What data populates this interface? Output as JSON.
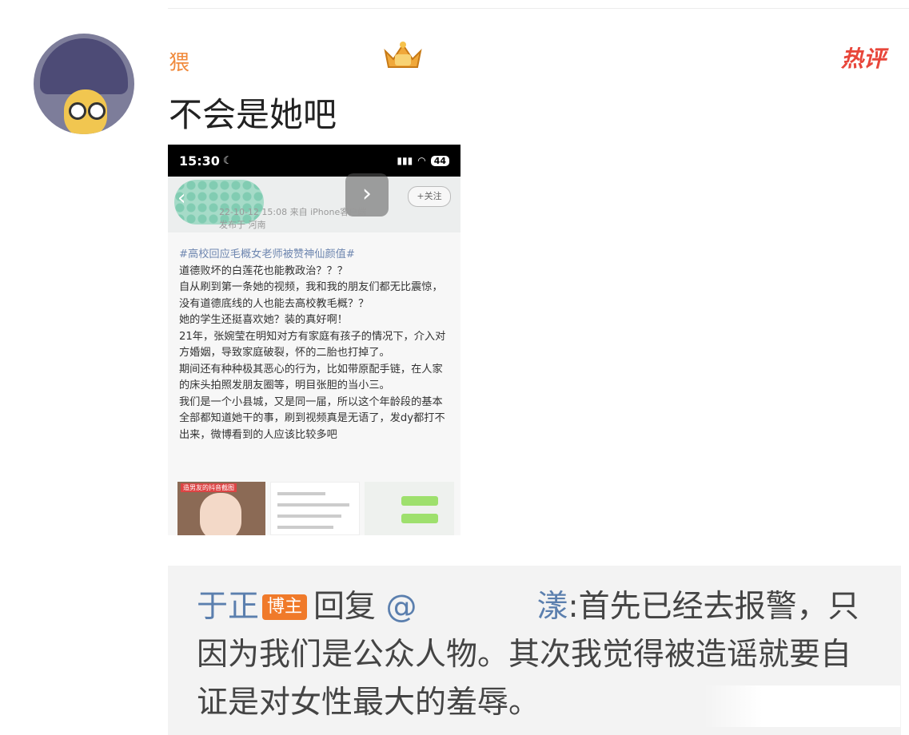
{
  "comment": {
    "username": "猥",
    "hot_label": "热评",
    "text": "不会是她吧"
  },
  "screenshot": {
    "status_time": "15:30",
    "battery": "44",
    "follow_label": "+关注",
    "meta_line1": "22-10-12 15:08  来自 iPhone客户端",
    "meta_line2": "发布于 河南",
    "hashtag": "#高校回应毛概女老师被赞神仙颜值#",
    "lines": [
      "道德败坏的白莲花也能教政治？？？",
      "自从刷到第一条她的视频，我和我的朋友们都无比震惊，没有道德底线的人也能去高校教毛概？？",
      "她的学生还挺喜欢她？装的真好啊！",
      "21年，张婉莹在明知对方有家庭有孩子的情况下，介入对方婚姻，导致家庭破裂，怀的二胎也打掉了。",
      "期间还有种种极其恶心的行为，比如带原配手链，在人家的床头拍照发朋友圈等，明目张胆的当小三。",
      "我们是一个小县城，又是同一届，所以这个年龄段的基本全部都知道她干的事，刷到视频真是无语了，发dy都打不出来，微博看到的人应该比较多吧"
    ],
    "thumb_label": "造男友的抖音截图"
  },
  "reply": {
    "nick": "于正",
    "badge": "博主",
    "reply_word": "回复",
    "at": "@",
    "target_tail": "漾",
    "content": ":首先已经去报警，只因为我们是公众人物。其次我觉得被造谣就要自证是对女性最大的羞辱。"
  }
}
